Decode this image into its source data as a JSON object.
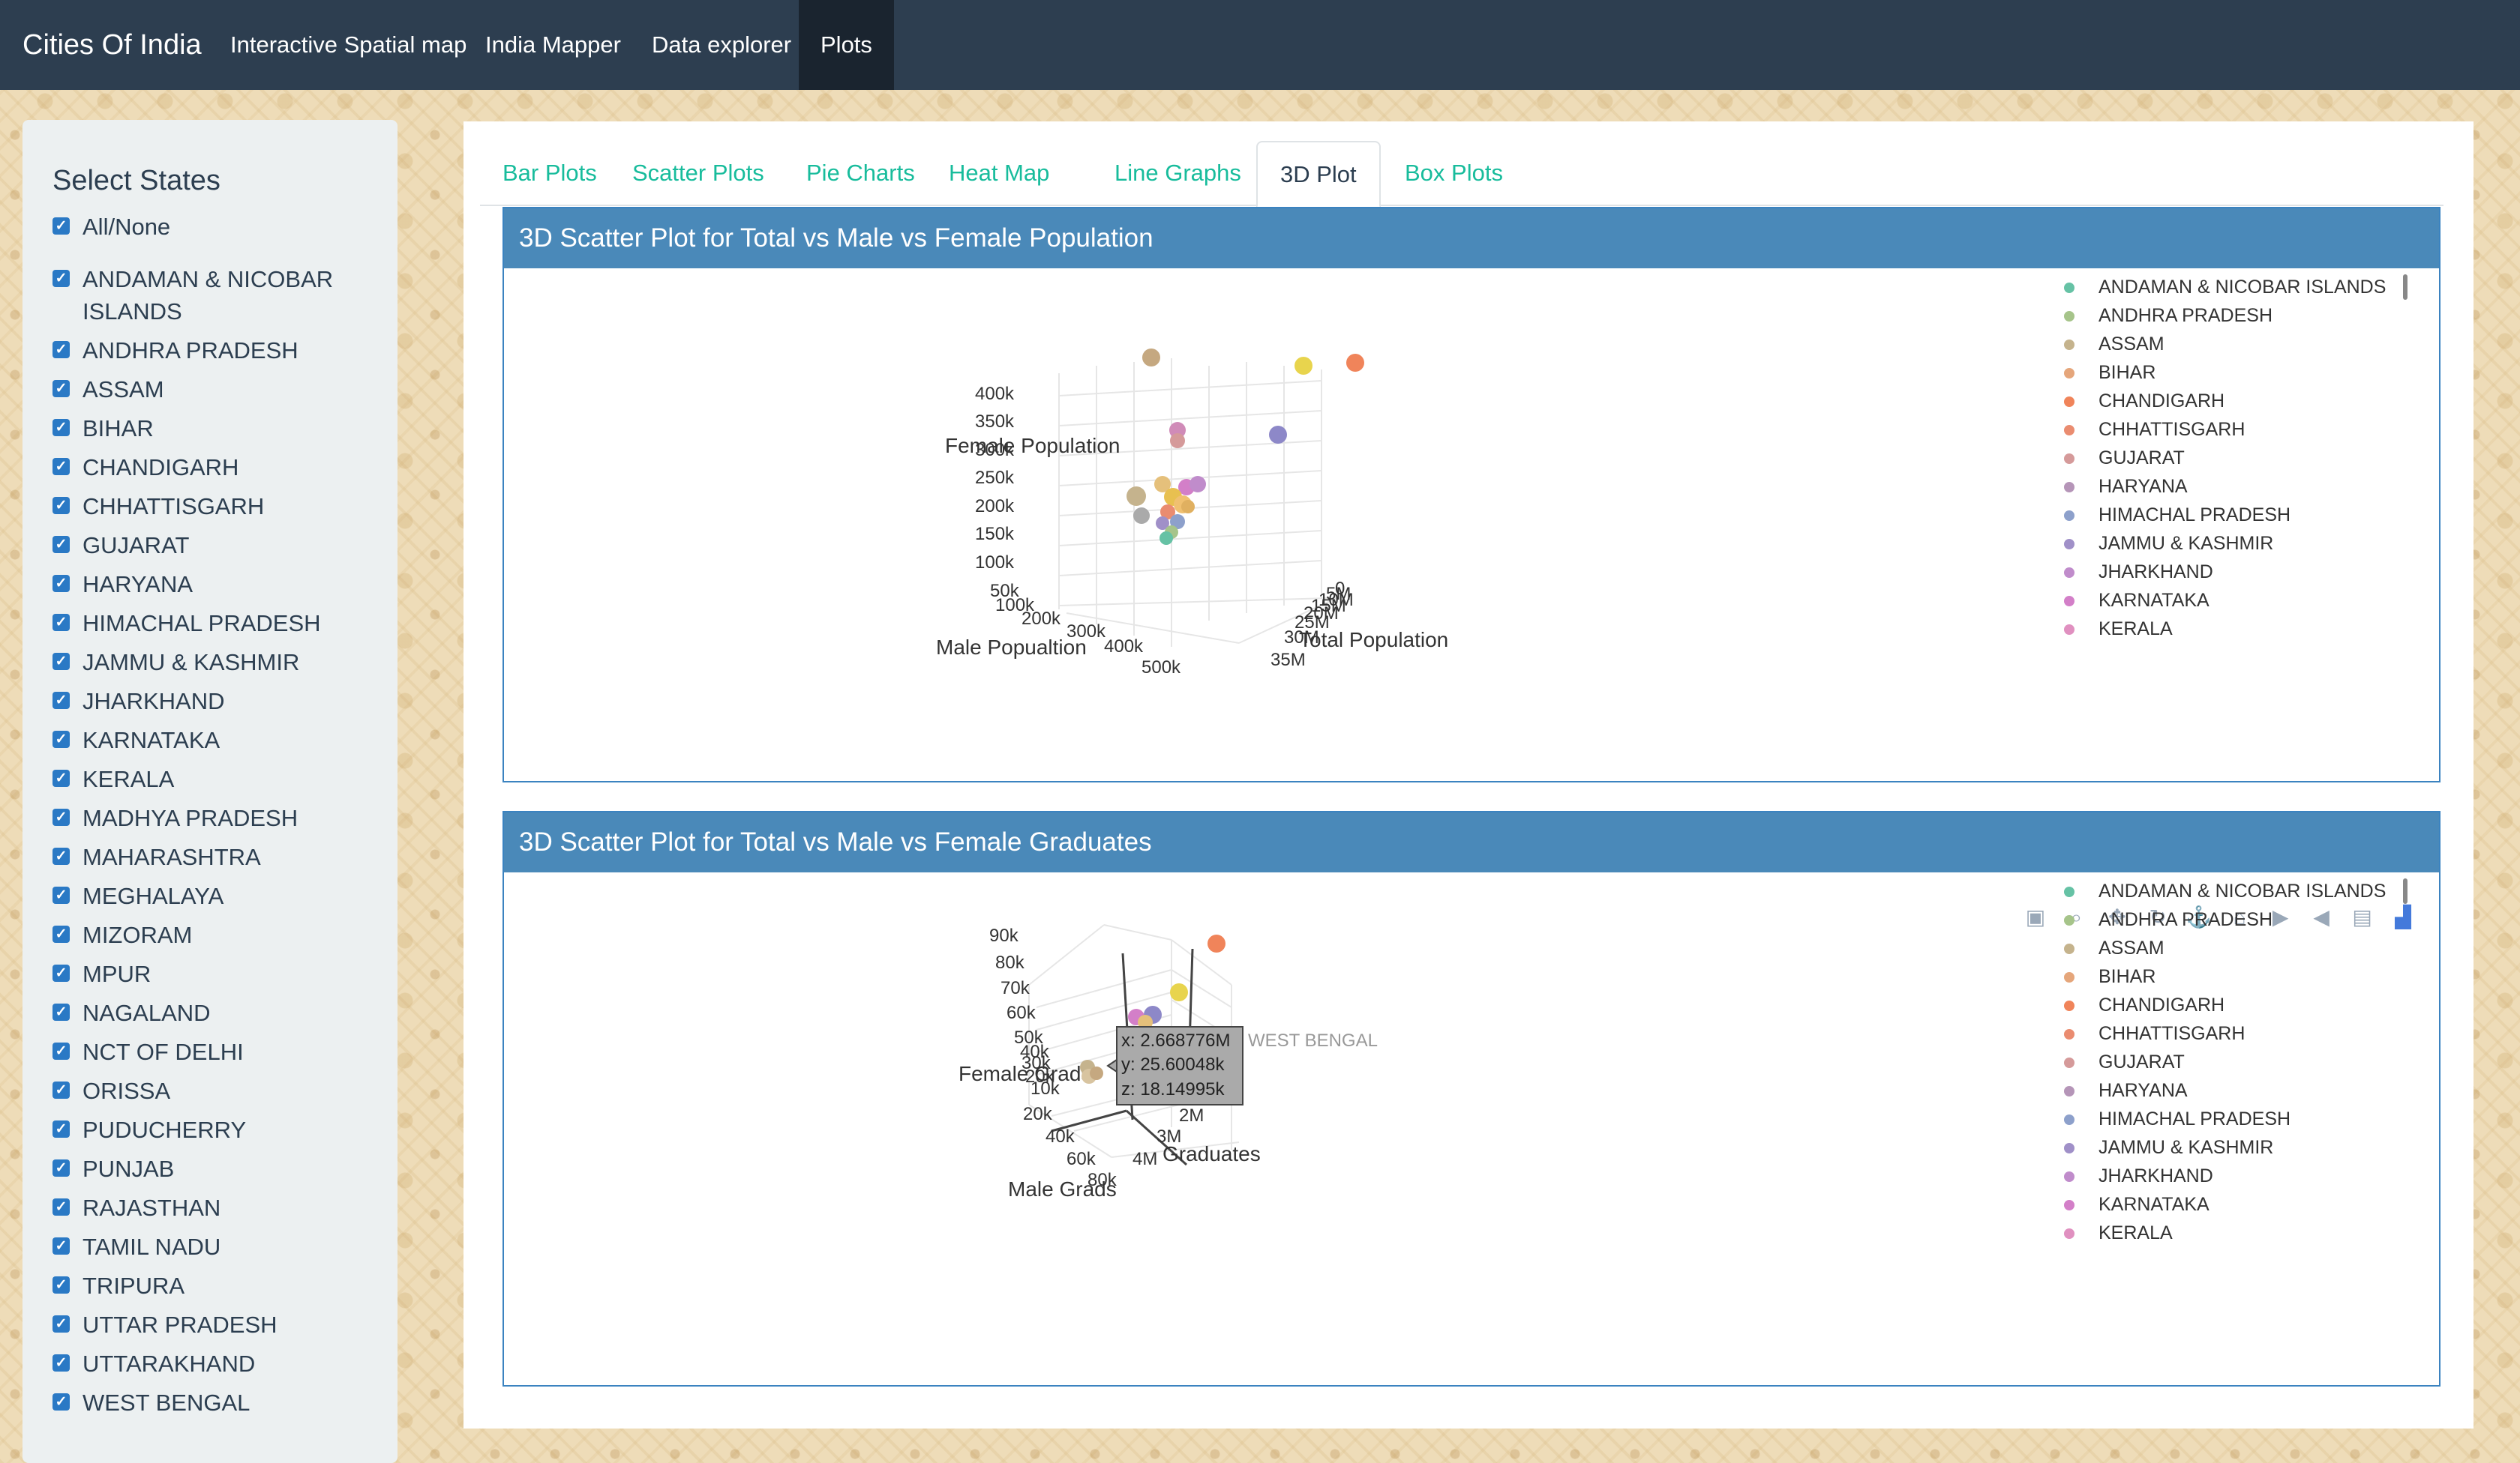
{
  "navbar": {
    "brand": "Cities Of India",
    "items": [
      "Interactive Spatial map",
      "India Mapper",
      "Data explorer",
      "Plots"
    ],
    "active": "Plots"
  },
  "sidebar": {
    "title": "Select States",
    "all_label": "All/None",
    "states": [
      "ANDAMAN & NICOBAR ISLANDS",
      "ANDHRA PRADESH",
      "ASSAM",
      "BIHAR",
      "CHANDIGARH",
      "CHHATTISGARH",
      "GUJARAT",
      "HARYANA",
      "HIMACHAL PRADESH",
      "JAMMU & KASHMIR",
      "JHARKHAND",
      "KARNATAKA",
      "KERALA",
      "MADHYA PRADESH",
      "MAHARASHTRA",
      "MEGHALAYA",
      "MIZORAM",
      "MPUR",
      "NAGALAND",
      "NCT OF DELHI",
      "ORISSA",
      "PUDUCHERRY",
      "PUNJAB",
      "RAJASTHAN",
      "TAMIL NADU",
      "TRIPURA",
      "UTTAR PRADESH",
      "UTTARAKHAND",
      "WEST BENGAL"
    ],
    "all_checked": true
  },
  "tabs": [
    "Bar Plots",
    "Scatter Plots",
    "Pie Charts",
    "Heat Map",
    "Line Graphs",
    "3D Plot",
    "Box Plots"
  ],
  "active_tab": "3D Plot",
  "panels": [
    {
      "title": "3D Scatter Plot for Total vs Male vs Female Population",
      "axes": {
        "x": {
          "title": "Total Population",
          "ticks": [
            "0",
            "5M",
            "10M",
            "15M",
            "20M",
            "25M",
            "30M",
            "35M"
          ]
        },
        "y": {
          "title": "Male Popualtion",
          "ticks": [
            "100k",
            "200k",
            "300k",
            "400k",
            "500k"
          ]
        },
        "z": {
          "title": "Female Population",
          "ticks": [
            "50k",
            "100k",
            "150k",
            "200k",
            "250k",
            "300k",
            "350k",
            "400k"
          ]
        }
      },
      "legend": [
        "ANDAMAN & NICOBAR ISLANDS",
        "ANDHRA PRADESH",
        "ASSAM",
        "BIHAR",
        "CHANDIGARH",
        "CHHATTISGARH",
        "GUJARAT",
        "HARYANA",
        "HIMACHAL PRADESH",
        "JAMMU & KASHMIR",
        "JHARKHAND",
        "KARNATAKA",
        "KERALA"
      ]
    },
    {
      "title": "3D Scatter Plot for Total vs Male vs Female Graduates",
      "axes": {
        "x": {
          "title": "Graduates",
          "ticks": [
            "0",
            "1M",
            "2M",
            "3M",
            "4M"
          ]
        },
        "y": {
          "title": "Male Grads",
          "ticks": [
            "20k",
            "40k",
            "60k",
            "80k"
          ]
        },
        "z": {
          "title": "Female Grads",
          "ticks": [
            "10k",
            "20k",
            "30k",
            "40k",
            "50k",
            "60k",
            "70k",
            "80k",
            "90k"
          ]
        }
      },
      "tooltip": {
        "x": "x: 2.668776M",
        "y": "y: 25.60048k",
        "z": "z: 18.14995k",
        "series": "WEST BENGAL"
      },
      "legend": [
        "ANDAMAN & NICOBAR ISLANDS",
        "ANDHRA PRADESH",
        "ASSAM",
        "BIHAR",
        "CHANDIGARH",
        "CHHATTISGARH",
        "GUJARAT",
        "HARYANA",
        "HIMACHAL PRADESH",
        "JAMMU & KASHMIR",
        "JHARKHAND",
        "KARNATAKA",
        "KERALA"
      ],
      "modebar": [
        "camera-icon",
        "zoom-icon",
        "pan-icon",
        "orbit-icon",
        "turntable-icon",
        "home-icon",
        "reset-view-icon",
        "hover-closest-icon",
        "hover-compare-icon",
        "plotly-logo-icon"
      ]
    }
  ],
  "colors": {
    "navbar": "#2d3e50",
    "panel_header": "#4a89b9",
    "tab_link": "#18bc9c",
    "series": [
      "#66c2a5",
      "#a6c48a",
      "#c5b38d",
      "#e5a67b",
      "#f0845a",
      "#ea8c70",
      "#d59a9a",
      "#b595b8",
      "#8da0cb",
      "#a090c8",
      "#c08ccb",
      "#d37fc8",
      "#e090c0"
    ]
  },
  "chart_data": [
    {
      "type": "scatter",
      "title": "3D Scatter Plot for Total vs Male vs Female Population",
      "xlabel": "Total Population",
      "ylabel": "Male Popualtion",
      "zlabel": "Female Population"
    },
    {
      "type": "scatter",
      "title": "3D Scatter Plot for Total vs Male vs Female Graduates",
      "xlabel": "Graduates",
      "ylabel": "Male Grads",
      "zlabel": "Female Grads",
      "points": [
        {
          "series": "WEST BENGAL",
          "x": 2668776,
          "y": 25600.48,
          "z": 18149.95
        }
      ]
    }
  ]
}
